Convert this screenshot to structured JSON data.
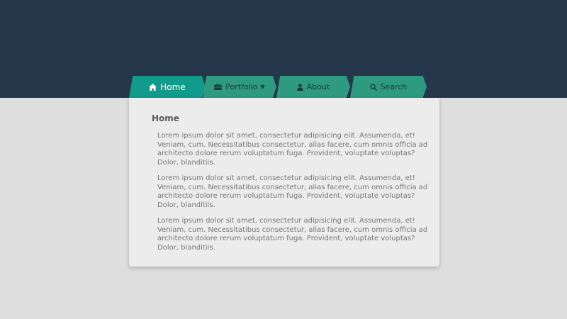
{
  "colors": {
    "header_bg": "#25374a",
    "page_bg": "#dedede",
    "active_tab": "#119b8a",
    "tab": "#2e9a80",
    "card_bg": "#ececec"
  },
  "nav": {
    "tabs": [
      {
        "label": "Home",
        "icon": "home-icon",
        "active": true
      },
      {
        "label": "Portfolio",
        "icon": "briefcase-icon",
        "has_dropdown": true
      },
      {
        "label": "About",
        "icon": "user-icon"
      },
      {
        "label": "Search",
        "icon": "search-icon"
      }
    ]
  },
  "content": {
    "title": "Home",
    "paragraphs": [
      "Lorem ipsum dolor sit amet, consectetur adipisicing elit. Assumenda, et! Veniam, cum. Necessitatibus consectetur, alias facere, cum omnis officia ad architecto dolore rerum voluptatum fuga. Provident, voluptate voluptas? Dolor, blanditiis.",
      "Lorem ipsum dolor sit amet, consectetur adipisicing elit. Assumenda, et! Veniam, cum. Necessitatibus consectetur, alias facere, cum omnis officia ad architecto dolore rerum voluptatum fuga. Provident, voluptate voluptas? Dolor, blanditiis.",
      "Lorem ipsum dolor sit amet, consectetur adipisicing elit. Assumenda, et! Veniam, cum. Necessitatibus consectetur, alias facere, cum omnis officia ad architecto dolore rerum voluptatum fuga. Provident, voluptate voluptas? Dolor, blanditiis."
    ]
  }
}
